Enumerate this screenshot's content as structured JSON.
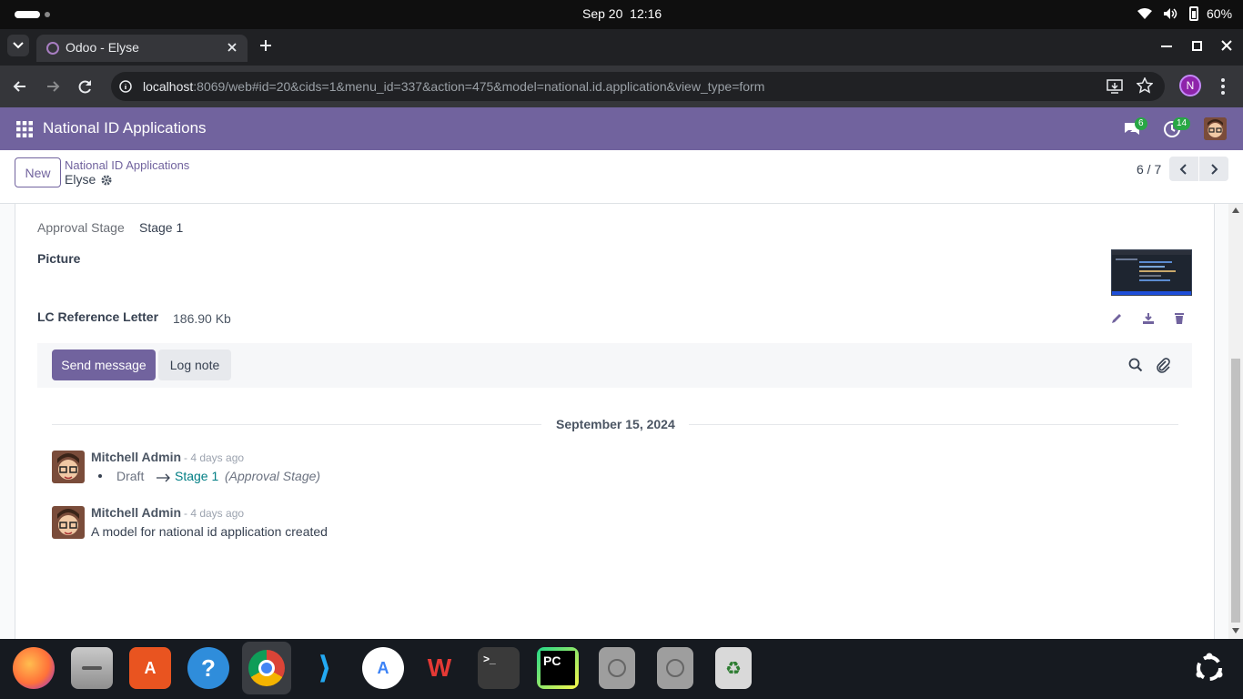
{
  "system": {
    "date": "Sep 20",
    "time": "12:16",
    "battery": "60%"
  },
  "browser": {
    "tab_title": "Odoo - Elyse",
    "url_host": "localhost",
    "url_rest": ":8069/web#id=20&cids=1&menu_id=337&action=475&model=national.id.application&view_type=form",
    "profile_initial": "N"
  },
  "odoo": {
    "app_title": "National ID Applications",
    "messages_count": "6",
    "activities_count": "14",
    "new_label": "New",
    "breadcrumb_parent": "National ID Applications",
    "record_name": "Elyse",
    "pager": "6 / 7"
  },
  "form": {
    "approval_stage_label": "Approval Stage",
    "approval_stage_value": "Stage 1",
    "picture_label": "Picture",
    "lc_label": "LC Reference Letter",
    "lc_size": "186.90 Kb"
  },
  "chatter": {
    "send_message_label": "Send message",
    "log_note_label": "Log note",
    "date_separator": "September 15, 2024",
    "messages": [
      {
        "author": "Mitchell Admin",
        "time": "- 4 days ago",
        "old_value": "Draft",
        "new_value": "Stage 1",
        "field": "(Approval Stage)"
      },
      {
        "author": "Mitchell Admin",
        "time": "- 4 days ago",
        "body": "A model for national id application created"
      }
    ]
  },
  "colors": {
    "odoo_purple": "#71639e",
    "link_teal": "#017e84",
    "chrome_dark": "#202124"
  }
}
